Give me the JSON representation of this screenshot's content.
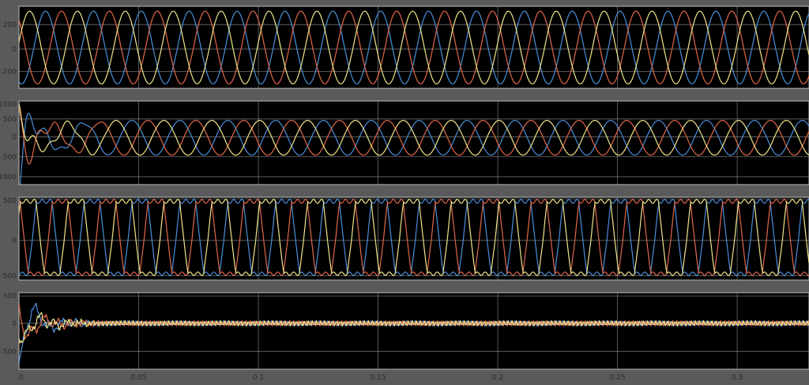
{
  "window": {
    "type": "scope-display",
    "background": "#5a5a5a",
    "axes_background": "#000000",
    "grid_color": "#9a9a9a"
  },
  "chart_data": [
    {
      "type": "line",
      "x_range": [
        0,
        0.33
      ],
      "ylim": [
        -350,
        350
      ],
      "yticks": [
        "200",
        "0",
        "-200"
      ],
      "grid": true,
      "waveform": "sine",
      "frequency_hz": 50,
      "series": [
        {
          "color": "#4a8fd9",
          "amplitude": 310,
          "phase_deg": -110
        },
        {
          "color": "#e0684a",
          "amplitude": 310,
          "phase_deg": 130
        },
        {
          "color": "#f0e68a",
          "amplitude": 310,
          "phase_deg": 10
        }
      ]
    },
    {
      "type": "line",
      "x_range": [
        0,
        0.33
      ],
      "ylim": [
        -1200,
        1000
      ],
      "yticks": [
        "1000",
        "500",
        "0",
        "-500",
        "-1000"
      ],
      "grid": true,
      "waveform": "sine-with-startup-transient",
      "frequency_hz": 50,
      "settle_time": 0.04,
      "series": [
        {
          "color": "#4a8fd9",
          "amplitude": 460,
          "phase_deg": -40,
          "transient_peak": -1100
        },
        {
          "color": "#e0684a",
          "amplitude": 460,
          "phase_deg": 200,
          "transient_peak": 750
        },
        {
          "color": "#f0e68a",
          "amplitude": 460,
          "phase_deg": 80,
          "transient_peak": 620
        }
      ]
    },
    {
      "type": "line",
      "x_range": [
        0,
        0.33
      ],
      "ylim": [
        -560,
        520
      ],
      "yticks": [
        "500",
        "0",
        "-500"
      ],
      "grid": true,
      "waveform": "flat-top-inverter",
      "frequency_hz": 50,
      "series": [
        {
          "color": "#4a8fd9",
          "amplitude": 470,
          "phase_deg": -100
        },
        {
          "color": "#e0684a",
          "amplitude": 470,
          "phase_deg": 140
        },
        {
          "color": "#f0e68a",
          "amplitude": 470,
          "phase_deg": 20
        }
      ]
    },
    {
      "type": "line",
      "x_range": [
        0,
        0.33
      ],
      "ylim": [
        -820,
        560
      ],
      "yticks": [
        "500",
        "0",
        "-500"
      ],
      "xticks": [
        "0",
        "0.05",
        "0.1",
        "0.15",
        "0.2",
        "0.25",
        "0.3"
      ],
      "xtick_values": [
        0,
        0.05,
        0.1,
        0.15,
        0.2,
        0.25,
        0.3
      ],
      "grid": true,
      "waveform": "decaying-transient-plus-ripple",
      "settle_time": 0.035,
      "series": [
        {
          "color": "#4a8fd9",
          "transient_peak": -750,
          "ripple": 45
        },
        {
          "color": "#e0684a",
          "transient_peak": 420,
          "ripple": 45
        },
        {
          "color": "#f0e68a",
          "transient_peak": 380,
          "ripple": 45
        }
      ]
    }
  ]
}
